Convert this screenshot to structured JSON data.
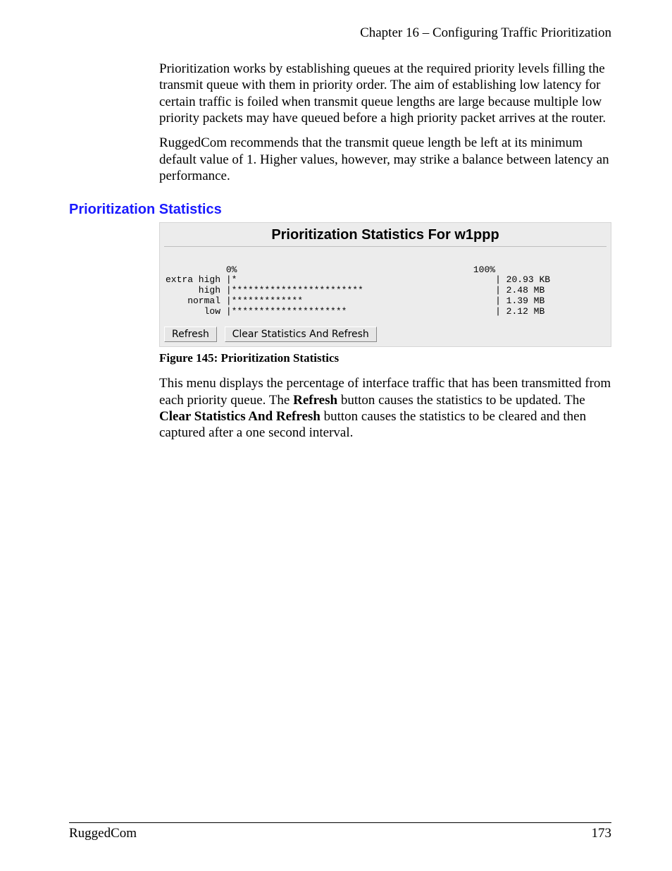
{
  "header": {
    "chapter": "Chapter 16 – Configuring Traffic Prioritization"
  },
  "body": {
    "para1": "Prioritization works by establishing queues at the required priority levels filling the transmit queue with them in priority order.  The aim of establishing low latency for certain traffic is foiled when transmit queue lengths are large because multiple low priority packets may have queued before a high priority packet arrives at the router.",
    "para2": "RuggedCom recommends that the transmit queue length be left at its minimum default value of 1.  Higher values, however, may strike a balance between latency an performance."
  },
  "section_heading": "Prioritization Statistics",
  "panel": {
    "title": "Prioritization Statistics For w1ppp",
    "buttons": {
      "refresh": "Refresh",
      "clear": "Clear Statistics And Refresh"
    }
  },
  "chart_data": {
    "type": "bar",
    "title": "Prioritization Statistics For w1ppp",
    "xlabel": "",
    "ylabel": "",
    "xlim": [
      "0%",
      "100%"
    ],
    "categories": [
      "extra high",
      "high",
      "normal",
      "low"
    ],
    "series": [
      {
        "name": "percent_asterisks",
        "values": [
          1,
          24,
          13,
          21
        ]
      },
      {
        "name": "bytes_label",
        "values": [
          "20.93 KB",
          "2.48 MB",
          "1.39 MB",
          "2.12 MB"
        ]
      }
    ],
    "axis_ticks": {
      "left": "0%",
      "right": "100%"
    }
  },
  "caption": "Figure 145:  Prioritization Statistics",
  "body2": {
    "text_a": "This menu displays the percentage of interface traffic that has been transmitted from each priority queue.  The ",
    "refresh_bold": "Refresh",
    "text_b": "  button causes the statistics to be updated.  The ",
    "clear_bold": "Clear Statistics And Refresh",
    "text_c": " button causes the statistics to be cleared and then captured after a one second interval."
  },
  "footer": {
    "left": "RuggedCom",
    "right": "173"
  }
}
